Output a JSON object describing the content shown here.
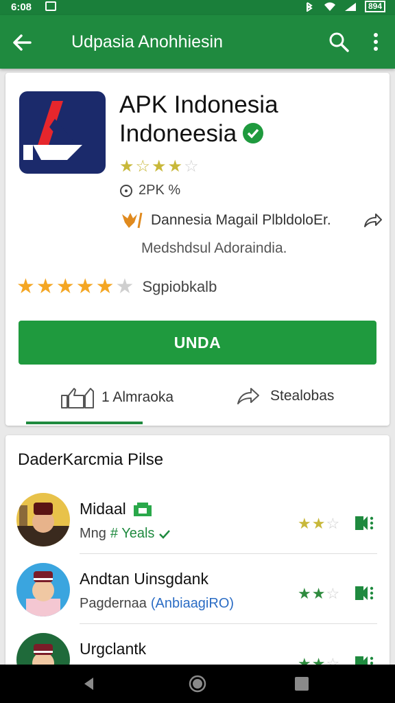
{
  "status_bar": {
    "time": "6:08",
    "battery": "894"
  },
  "app_bar": {
    "title": "Udpasia Anohhiesin"
  },
  "app": {
    "name_line1": "APK Indonesia",
    "name_line2": "Indoneesia",
    "size": "2PK %",
    "developer": "Dannesia Magail PlbldoloEr.",
    "description": "Medshdsul Adoraindia.",
    "rating_label": "Sgpiobkalb",
    "install_label": "UNDA",
    "like_label": "1 Almraoka",
    "share_label": "Stealobas",
    "title_rating": 3,
    "user_rating": 5
  },
  "section": {
    "title": "DaderKarcmia Pilse",
    "items": [
      {
        "name": "Midaal",
        "sub_prefix": "Mng",
        "sub_accent": "# Yeals",
        "sub_link": "",
        "rating": 2.5
      },
      {
        "name": "Andtan Uinsgdank",
        "sub_prefix": "Pagdernaa",
        "sub_accent": "",
        "sub_link": "(AnbiaagiRO)",
        "rating": 2.5
      },
      {
        "name": "Urgclantk",
        "sub_prefix": "",
        "sub_accent": "",
        "sub_link": "",
        "rating": 2.5
      }
    ]
  },
  "colors": {
    "brand_green": "#1f8a3f",
    "star_orange": "#f4a623",
    "link_blue": "#2a6cc4"
  }
}
